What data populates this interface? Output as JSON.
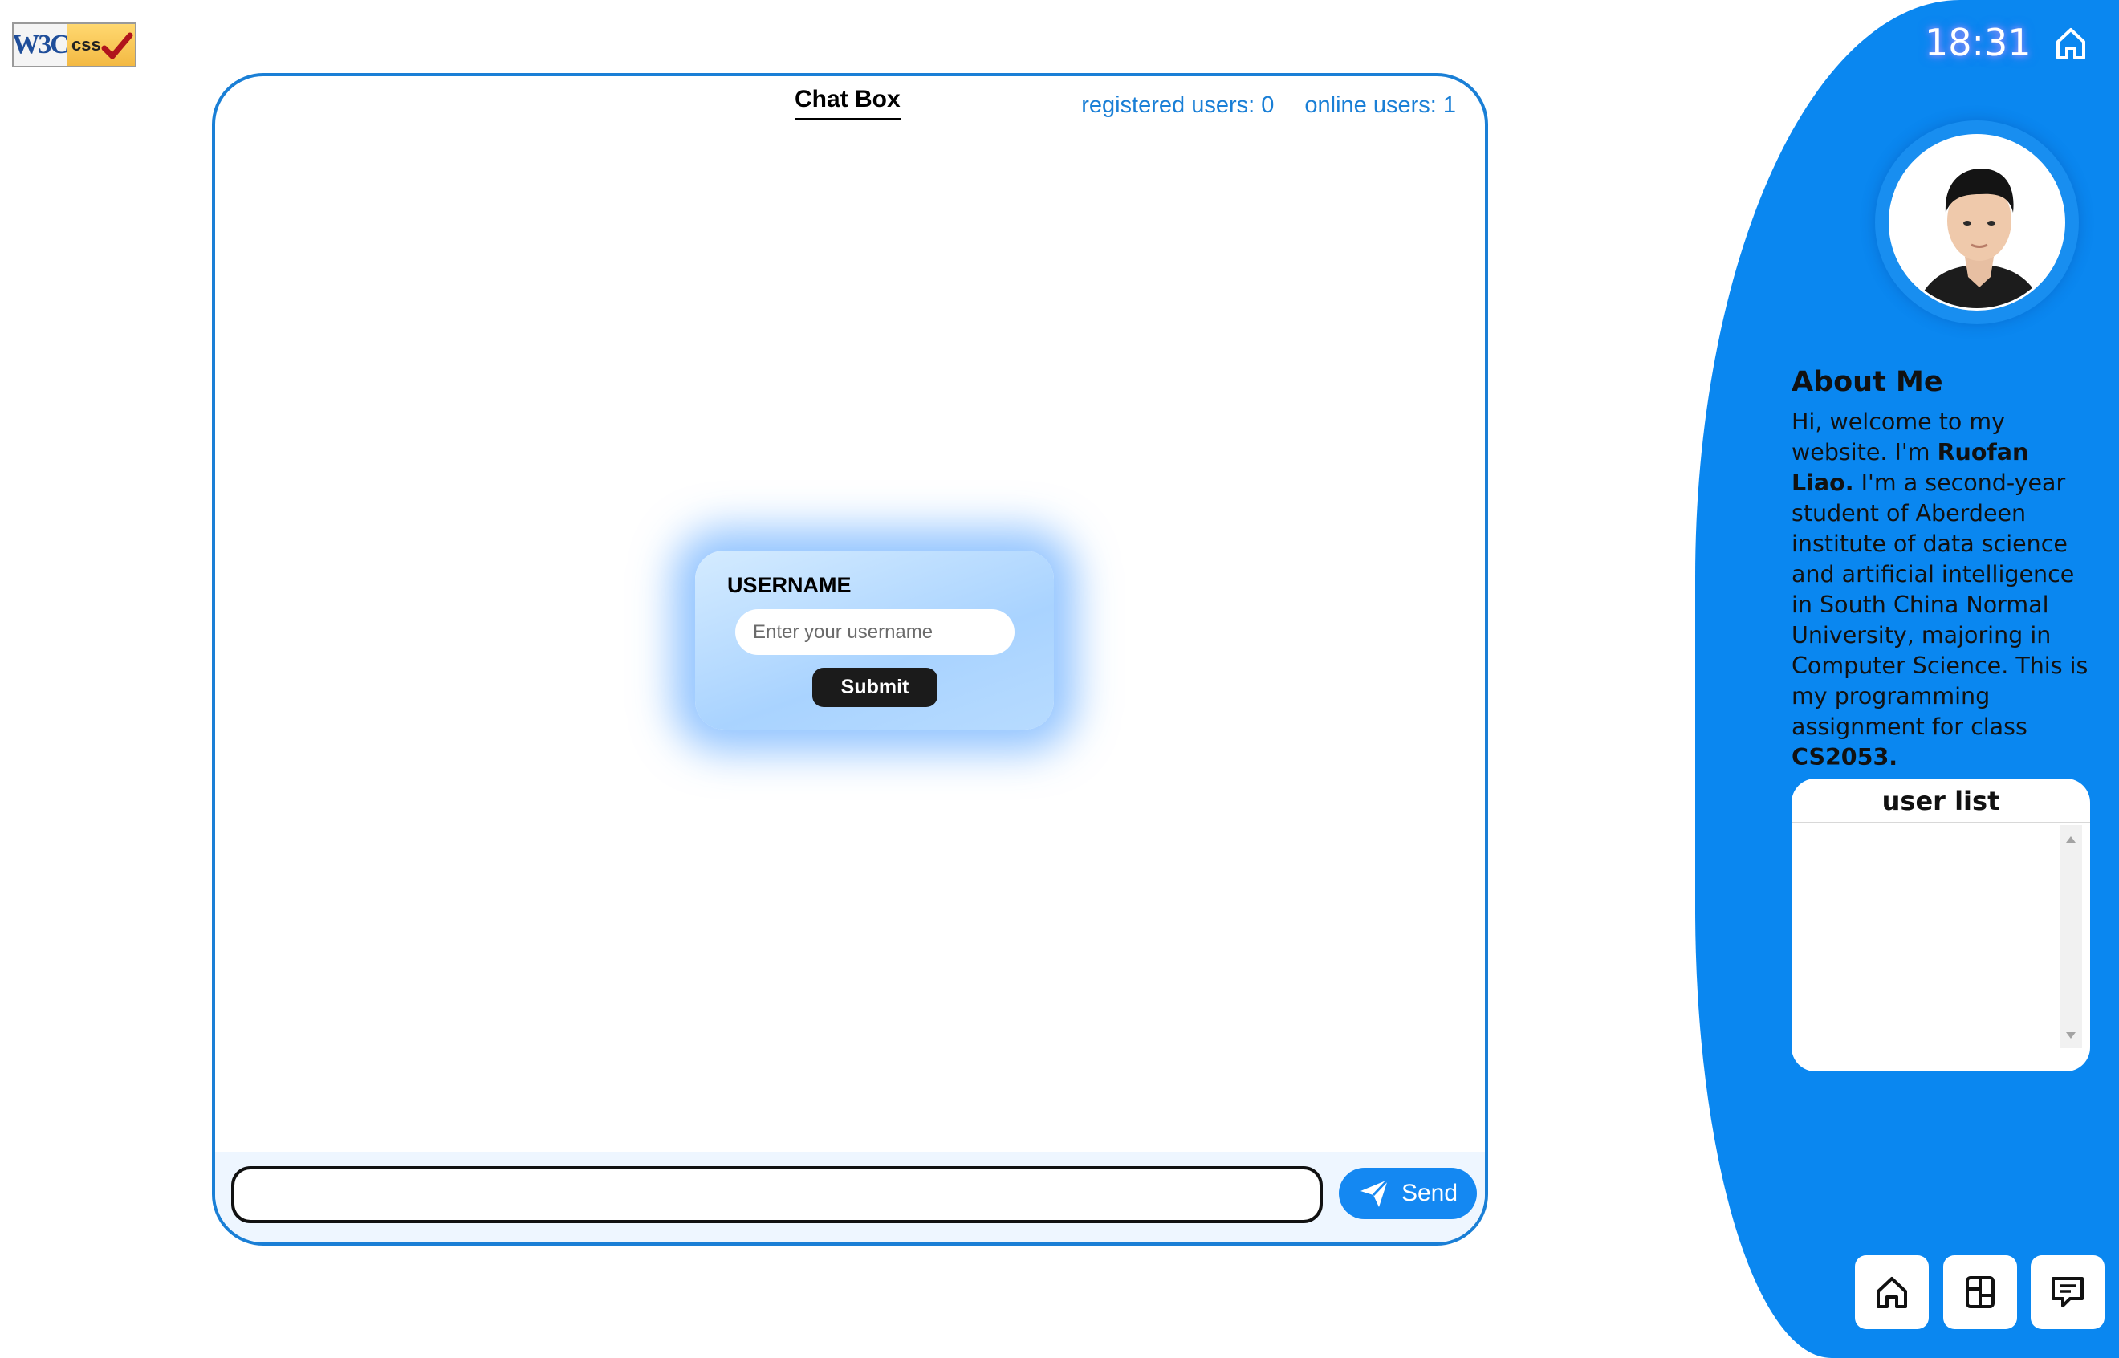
{
  "badge": {
    "w3c_text": "W3C",
    "css_text": "css"
  },
  "chat": {
    "title": "Chat Box",
    "registered_users": "registered users: 0",
    "online_users": "online users: 1",
    "login": {
      "label": "USERNAME",
      "placeholder": "Enter your username",
      "submit_label": "Submit"
    },
    "message_value": "",
    "send_label": "Send",
    "send_icon": "paper-plane-icon"
  },
  "sidebar": {
    "time": "18:31",
    "home_icon": "home-icon",
    "about_title": "About Me",
    "about_text": {
      "p1": "Hi, welcome to my website. I'm ",
      "name": "Ruofan Liao.",
      "p2": " I'm a second-year student of Aberdeen institute of data science and artificial intelligence in South China Normal University, majoring in Computer Science. This is my programming assignment for class ",
      "course": "CS2053."
    },
    "user_list_title": "user list",
    "user_list_items": []
  },
  "nav": [
    {
      "icon": "home-icon"
    },
    {
      "icon": "layout-grid-icon"
    },
    {
      "icon": "chat-message-icon"
    }
  ],
  "colors": {
    "accent": "#1a7fd6",
    "sidebar": "#0a87f0",
    "send_button": "#1488f2",
    "submit_button": "#1b1b1b"
  }
}
